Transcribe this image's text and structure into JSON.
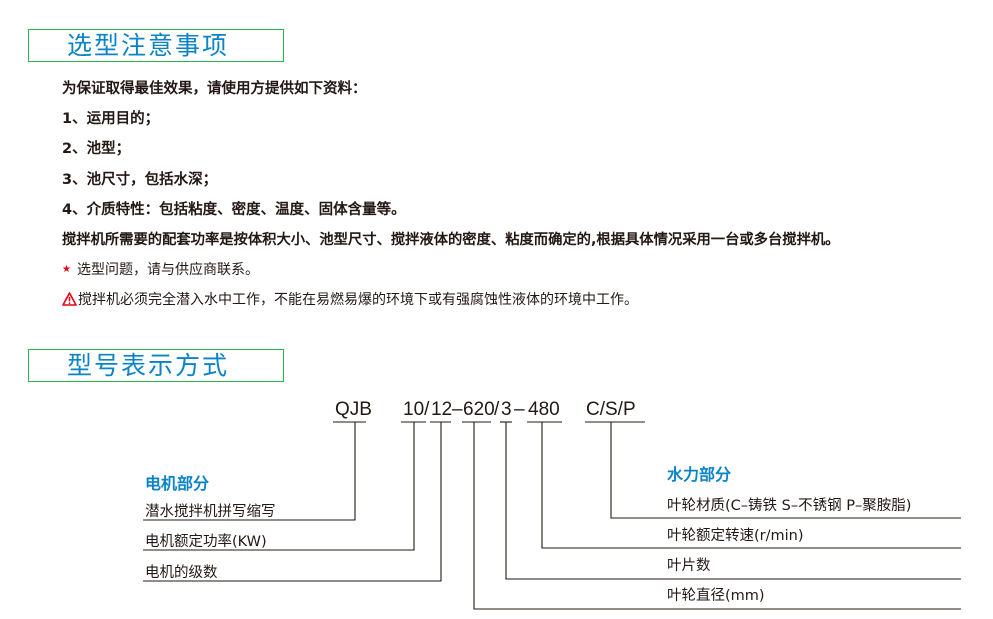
{
  "sections": {
    "notes_title": "选型注意事项",
    "model_title": "型号表示方式"
  },
  "notes": {
    "intro": "为保证取得最佳效果，请使用方提供如下资料：",
    "item1": "1、运用目的；",
    "item2": "2、池型；",
    "item3": "3、池尺寸，包括水深；",
    "item4": "4、介质特性：包括粘度、密度、温度、固体含量等。",
    "power": "搅拌机所需要的配套功率是按体积大小、池型尺寸、搅拌液体的密度、粘度而确定的,根据具体情况采用一台或多台搅拌机。",
    "star_note": "选型问题，请与供应商联系。",
    "warning": "搅拌机必须完全潜入水中工作，不能在易燃易爆的环境下或有强腐蚀性液体的环境中工作。"
  },
  "model": {
    "seg_qjb": "QJB",
    "seg_power": "10/",
    "seg_level": "12",
    "seg_dash1": "–",
    "seg_dia": "620",
    "seg_slash": "/",
    "seg_blades": "3",
    "seg_dash2": "–",
    "seg_speed": "480",
    "seg_material": "C/S/P"
  },
  "motor": {
    "title": "电机部分",
    "abbr": "潜水搅拌机拼写缩写",
    "power": "电机额定功率(KW)",
    "level": "电机的级数"
  },
  "hydraulic": {
    "title": "水力部分",
    "material": "叶轮材质(C–铸铁 S–不锈钢 P–聚胺脂)",
    "speed": "叶轮额定转速(r/min)",
    "blades": "叶片数",
    "diameter": "叶轮直径(mm)"
  },
  "colors": {
    "title_blue": "#0a84c6",
    "frame_green": "#2bb34a",
    "star_red": "#e60012"
  }
}
